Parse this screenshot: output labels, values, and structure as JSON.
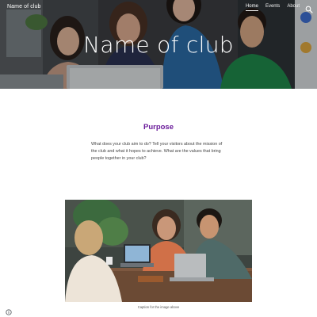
{
  "header": {
    "site_name": "Name of club",
    "nav": [
      {
        "label": "Home",
        "active": true
      },
      {
        "label": "Events",
        "active": false
      },
      {
        "label": "About",
        "active": false
      }
    ],
    "search_icon": "search-icon"
  },
  "hero": {
    "title": "Name of club"
  },
  "purpose": {
    "heading": "Purpose",
    "body": "What does your club aim to do? Tell your visitors about the mission of the club and what it hopes to achieve. What are the values that bring people together in your club?"
  },
  "image": {
    "caption": "Caption for the image above"
  },
  "footer": {
    "info_icon": "info-icon"
  },
  "colors": {
    "heading": "#6a1b9a",
    "hero_text": "#ffffff",
    "body_text": "#444444"
  }
}
